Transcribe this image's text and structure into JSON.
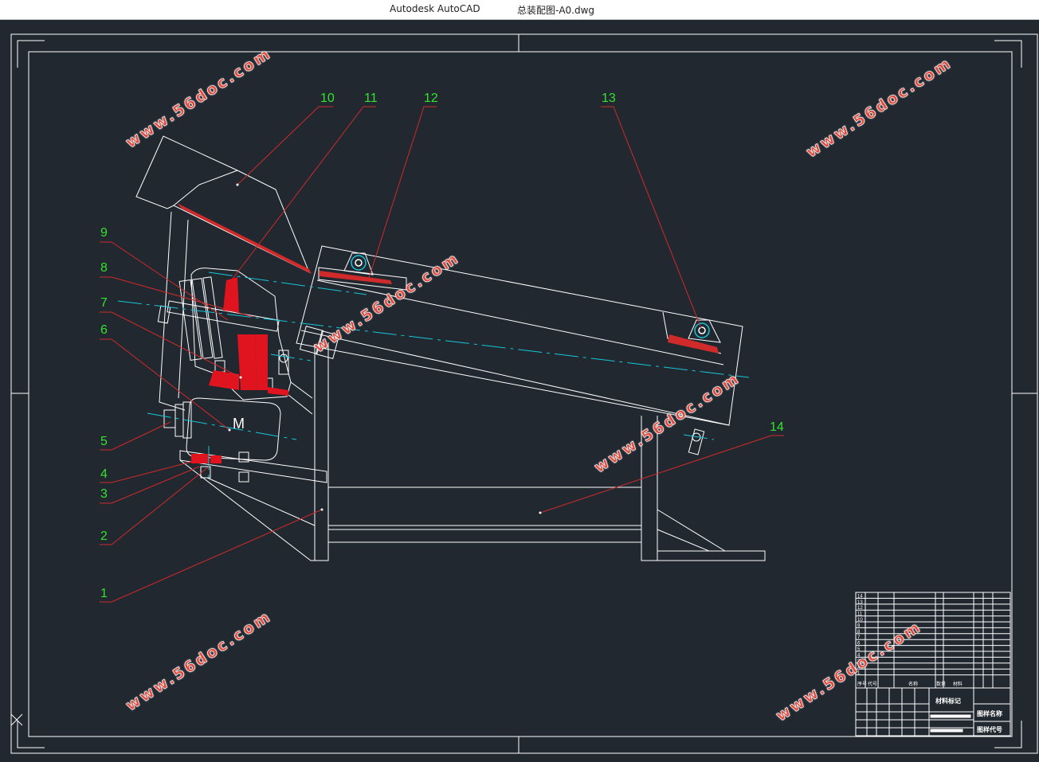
{
  "window": {
    "app_name": "Autodesk AutoCAD",
    "document_name": "总装配图-A0.dwg"
  },
  "drawing": {
    "part_labels": [
      "1",
      "2",
      "3",
      "4",
      "5",
      "6",
      "7",
      "8",
      "9",
      "10",
      "11",
      "12",
      "13",
      "14"
    ],
    "motor_symbol": "M",
    "colors": {
      "background": "#212830",
      "lines": "#ffffff",
      "leader": "#d02a2a",
      "label": "#35e22d",
      "centerline": "#17c6d8",
      "section_fill": "#e0141e"
    }
  },
  "title_block": {
    "material_mark": "材料标记",
    "drawing_name": "图样名称",
    "drawing_code": "图样代号",
    "parts_rows": [
      "14",
      "13",
      "12",
      "11",
      "10",
      "9",
      "8",
      "7",
      "6",
      "5",
      "4",
      "3",
      "2",
      "1"
    ],
    "header_cells": [
      "序号",
      "代号",
      "名称",
      "数量",
      "材料"
    ]
  },
  "watermark": {
    "text": "www.56doc.com"
  }
}
